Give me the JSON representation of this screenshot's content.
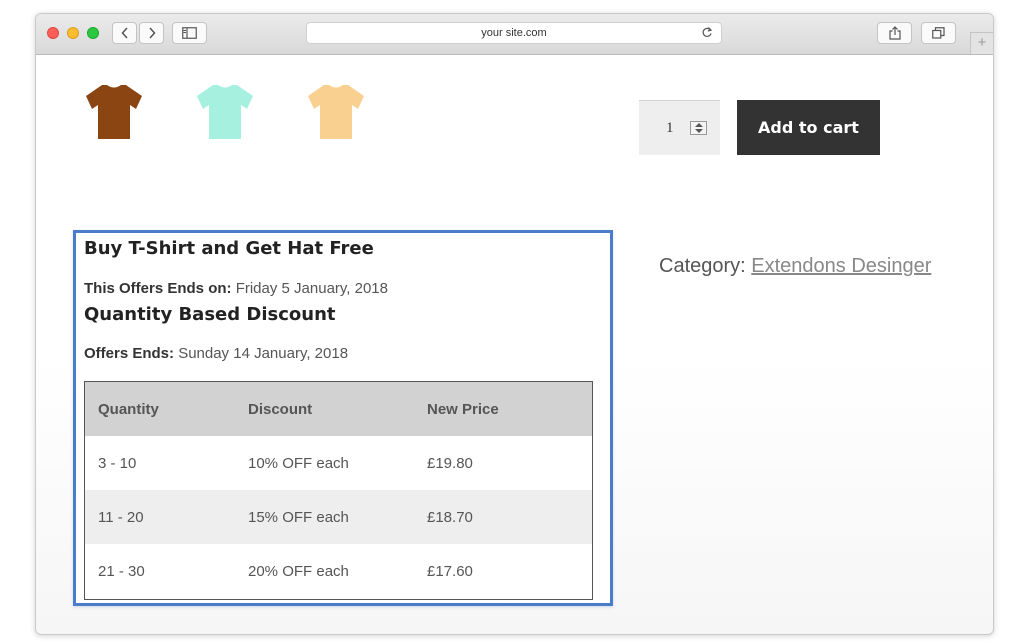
{
  "browser": {
    "url": "your site.com",
    "back_icon": "chevron-left-icon",
    "forward_icon": "chevron-right-icon",
    "sidebar_icon": "sidebar-icon",
    "reload_icon": "reload-icon",
    "share_icon": "share-icon",
    "tabs_icon": "tabs-icon",
    "new_tab_icon": "plus-icon",
    "new_tab_label": "+"
  },
  "product": {
    "swatches": [
      {
        "color": "#8b4513",
        "name": "brown-tshirt"
      },
      {
        "color": "#a6f0e0",
        "name": "mint-tshirt"
      },
      {
        "color": "#f9d08f",
        "name": "peach-tshirt"
      }
    ],
    "quantity": "1",
    "add_to_cart_label": "Add to cart",
    "category_label": "Category:",
    "category_link": "Extendons Desinger"
  },
  "offers": {
    "title": "Buy T-Shirt and Get Hat Free",
    "ends_label": "This Offers Ends on:",
    "ends_date": "Friday 5 January, 2018",
    "discount_title": "Quantity Based Discount",
    "discount_ends_label": "Offers Ends:",
    "discount_ends_date": "Sunday 14 January, 2018",
    "table": {
      "headers": [
        "Quantity",
        "Discount",
        "New Price"
      ],
      "rows": [
        [
          "3 - 10",
          "10% OFF each",
          "£19.80"
        ],
        [
          "11 - 20",
          "15% OFF each",
          "£18.70"
        ],
        [
          "21 - 30",
          "20% OFF each",
          "£17.60"
        ]
      ]
    }
  },
  "colors": {
    "highlight_border": "#4a7cc9",
    "button_bg": "#333333"
  }
}
